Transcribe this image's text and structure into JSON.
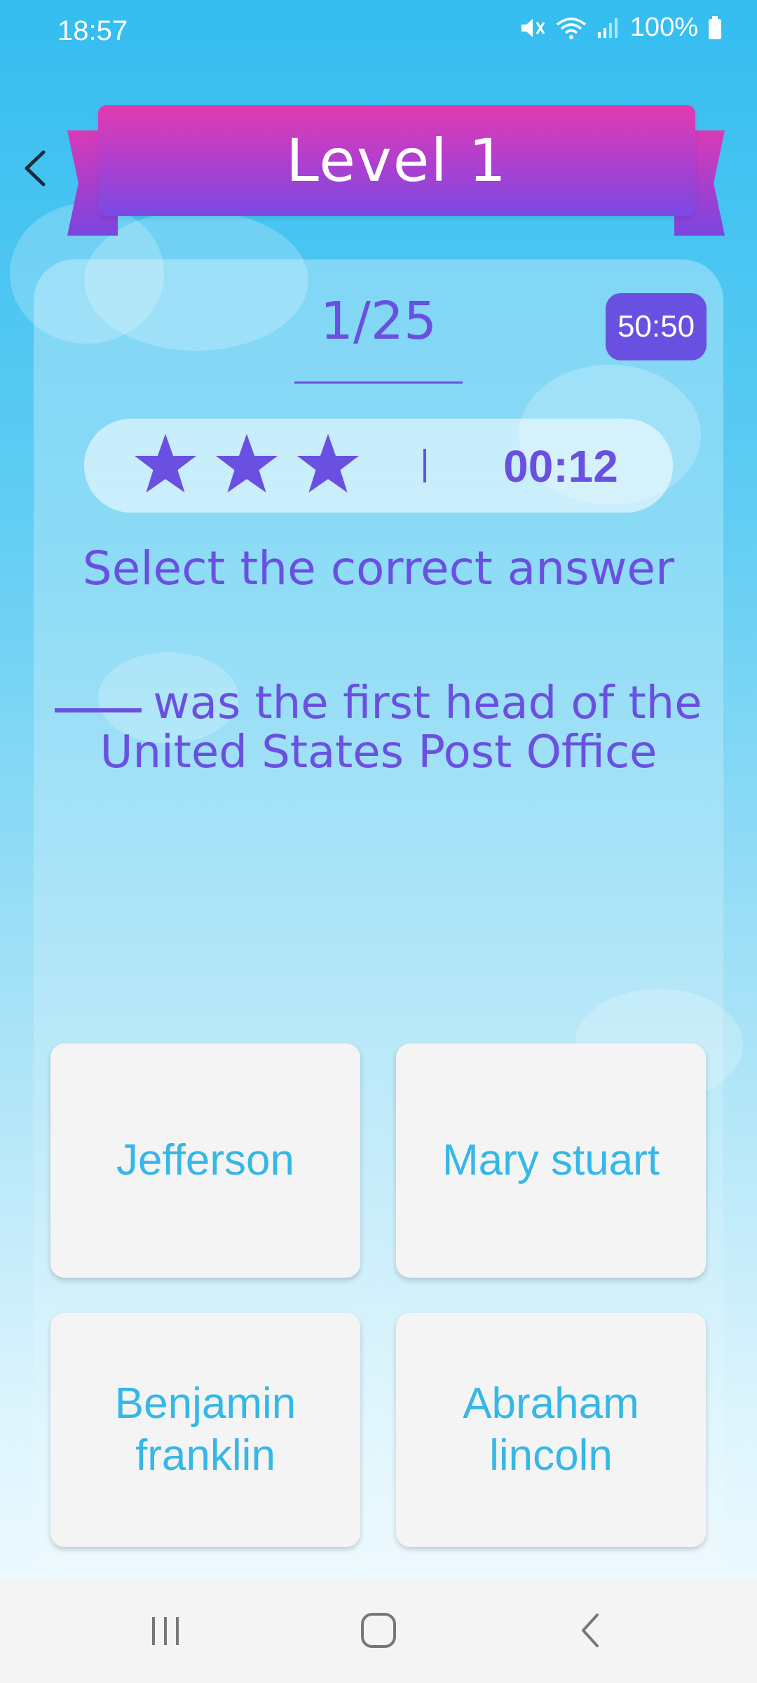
{
  "status_bar": {
    "time": "18:57",
    "battery": "100%",
    "icons": [
      "mute-icon",
      "wifi-icon",
      "signal-icon",
      "battery-icon"
    ]
  },
  "header": {
    "title": "Level 1",
    "back_icon": "chevron-left-icon"
  },
  "quiz": {
    "progress": "1/25",
    "lifeline_label": "50:50",
    "stars_count": 3,
    "timer": "00:12",
    "instruction": "Select the correct answer",
    "question": "was the first head of the United States Post Office"
  },
  "answers": [
    {
      "label": "Jefferson"
    },
    {
      "label": "Mary stuart"
    },
    {
      "label": "Benjamin franklin"
    },
    {
      "label": "Abraham lincoln"
    }
  ],
  "nav_bar": {
    "icons": [
      "recent-apps-icon",
      "home-icon",
      "back-icon"
    ]
  },
  "colors": {
    "accent": "#6a50e0",
    "answer_text": "#35b7e8",
    "banner_top": "#e23bb0",
    "banner_bottom": "#7a4ae4",
    "background_top": "#34bdf0"
  }
}
